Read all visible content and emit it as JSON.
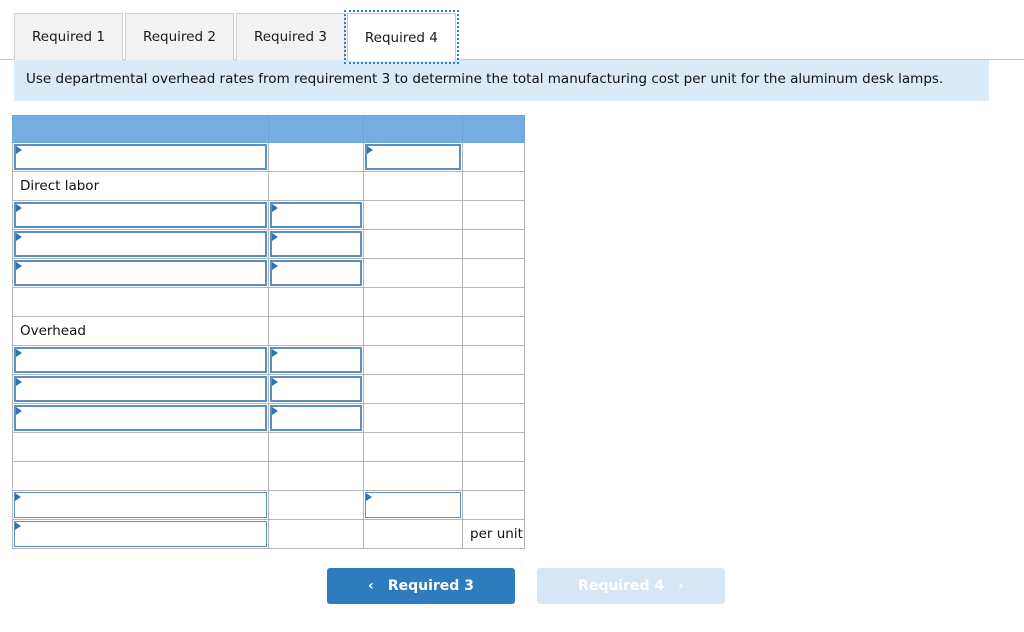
{
  "tabs": [
    {
      "label": "Required 1",
      "active": false
    },
    {
      "label": "Required 2",
      "active": false
    },
    {
      "label": "Required 3",
      "active": false
    },
    {
      "label": "Required 4",
      "active": true
    }
  ],
  "instruction": {
    "text": "Use departmental overhead rates from requirement 3 to determine the total manufacturing cost per unit for the aluminum desk lamps."
  },
  "worksheet": {
    "header_color": "#76ade3",
    "input_border_color": "#5b8fc4",
    "columns": [
      "",
      "",
      "",
      ""
    ],
    "rows": [
      {
        "type": "header",
        "cells": [
          "",
          "",
          "",
          ""
        ]
      },
      {
        "type": "data",
        "cells": [
          {
            "kind": "input",
            "value": ""
          },
          {
            "kind": "blank",
            "value": ""
          },
          {
            "kind": "input",
            "value": ""
          },
          {
            "kind": "blank",
            "value": ""
          }
        ]
      },
      {
        "type": "data",
        "cells": [
          {
            "kind": "label",
            "value": "Direct labor"
          },
          {
            "kind": "blank",
            "value": ""
          },
          {
            "kind": "blank",
            "value": ""
          },
          {
            "kind": "blank",
            "value": ""
          }
        ]
      },
      {
        "type": "data",
        "cells": [
          {
            "kind": "input",
            "value": ""
          },
          {
            "kind": "input",
            "value": ""
          },
          {
            "kind": "blank",
            "value": ""
          },
          {
            "kind": "blank",
            "value": ""
          }
        ]
      },
      {
        "type": "data",
        "cells": [
          {
            "kind": "input",
            "value": ""
          },
          {
            "kind": "input",
            "value": ""
          },
          {
            "kind": "blank",
            "value": ""
          },
          {
            "kind": "blank",
            "value": ""
          }
        ]
      },
      {
        "type": "data",
        "cells": [
          {
            "kind": "input",
            "value": ""
          },
          {
            "kind": "input",
            "value": ""
          },
          {
            "kind": "blank",
            "value": ""
          },
          {
            "kind": "blank",
            "value": ""
          }
        ]
      },
      {
        "type": "data",
        "cells": [
          {
            "kind": "blank",
            "value": ""
          },
          {
            "kind": "blank",
            "value": ""
          },
          {
            "kind": "blank",
            "value": ""
          },
          {
            "kind": "blank",
            "value": ""
          }
        ]
      },
      {
        "type": "data",
        "cells": [
          {
            "kind": "label",
            "value": "Overhead"
          },
          {
            "kind": "blank",
            "value": ""
          },
          {
            "kind": "blank",
            "value": ""
          },
          {
            "kind": "blank",
            "value": ""
          }
        ]
      },
      {
        "type": "data",
        "cells": [
          {
            "kind": "input",
            "value": ""
          },
          {
            "kind": "input",
            "value": ""
          },
          {
            "kind": "blank",
            "value": ""
          },
          {
            "kind": "blank",
            "value": ""
          }
        ]
      },
      {
        "type": "data",
        "cells": [
          {
            "kind": "input",
            "value": ""
          },
          {
            "kind": "input",
            "value": ""
          },
          {
            "kind": "blank",
            "value": ""
          },
          {
            "kind": "blank",
            "value": ""
          }
        ]
      },
      {
        "type": "data",
        "cells": [
          {
            "kind": "input",
            "value": ""
          },
          {
            "kind": "input",
            "value": ""
          },
          {
            "kind": "blank",
            "value": ""
          },
          {
            "kind": "blank",
            "value": ""
          }
        ]
      },
      {
        "type": "data",
        "cells": [
          {
            "kind": "blank",
            "value": ""
          },
          {
            "kind": "blank",
            "value": ""
          },
          {
            "kind": "blank",
            "value": ""
          },
          {
            "kind": "blank",
            "value": ""
          }
        ]
      },
      {
        "type": "data",
        "cells": [
          {
            "kind": "blank",
            "value": ""
          },
          {
            "kind": "blank",
            "value": ""
          },
          {
            "kind": "blank",
            "value": ""
          },
          {
            "kind": "blank",
            "value": ""
          }
        ]
      },
      {
        "type": "data",
        "cells": [
          {
            "kind": "input",
            "value": ""
          },
          {
            "kind": "blank",
            "value": ""
          },
          {
            "kind": "input",
            "value": ""
          },
          {
            "kind": "blank",
            "value": ""
          }
        ]
      },
      {
        "type": "data",
        "cells": [
          {
            "kind": "input",
            "value": ""
          },
          {
            "kind": "blank",
            "value": ""
          },
          {
            "kind": "blank",
            "value": ""
          },
          {
            "kind": "unit",
            "value": "per unit"
          }
        ]
      }
    ]
  },
  "nav": {
    "prev": {
      "label": "Required 3",
      "chevron": "‹",
      "state": "enabled"
    },
    "next": {
      "label": "Required 4",
      "chevron": "›",
      "state": "disabled"
    }
  },
  "colors": {
    "accent": "#2e7cbd",
    "header_blue": "#76ade3",
    "banner_blue": "#daeaf7",
    "disabled_blue": "#d6e6f4"
  }
}
